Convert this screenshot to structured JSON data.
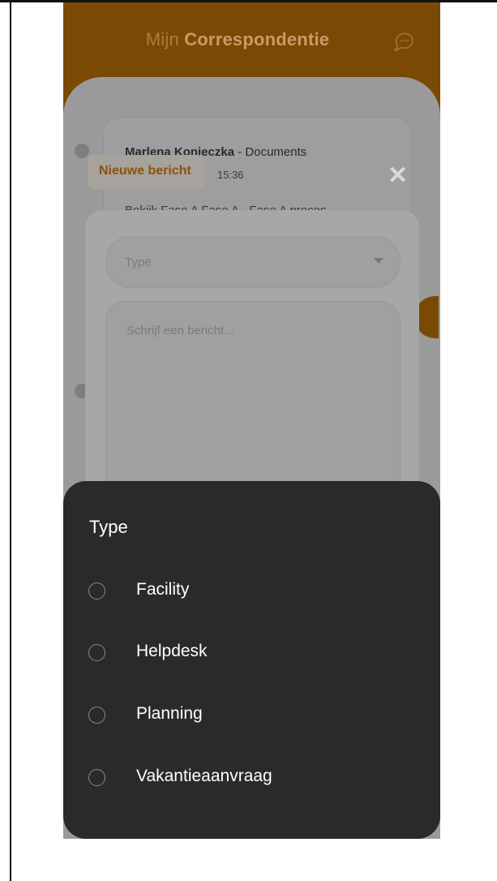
{
  "header": {
    "title_prefix": "Mijn",
    "title_main": "Correspondentie"
  },
  "message": {
    "sender": "Marlena Konieczka",
    "source": " - Documents",
    "time": "15:36",
    "preview": "Bekijk Fase A Fase A - Fase A proces-"
  },
  "compose": {
    "heading": "Nieuwe bericht",
    "type_placeholder": "Type",
    "message_placeholder": "Schrijf een bericht..."
  },
  "sheet": {
    "title": "Type",
    "options": [
      {
        "label": "Facility",
        "selected": false
      },
      {
        "label": "Helpdesk",
        "selected": false
      },
      {
        "label": "Planning",
        "selected": false
      },
      {
        "label": "Vakantieaanvraag",
        "selected": false
      }
    ]
  },
  "colors": {
    "brand": "#7a4a05",
    "sheet_bg": "#2a2a2a"
  },
  "icons": [
    "new-chat-icon",
    "close-icon",
    "chevron-down-icon",
    "radio-icon"
  ]
}
